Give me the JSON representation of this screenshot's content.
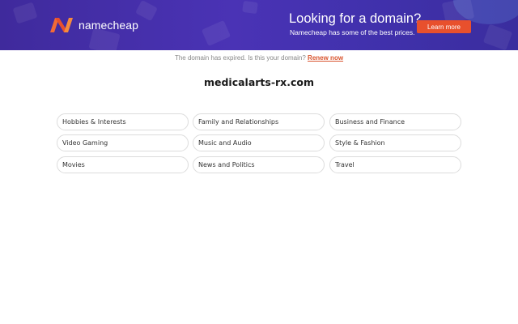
{
  "banner": {
    "logo_text": "namecheap",
    "logo_icon": "namecheap-n-icon",
    "promo_title": "Looking for a domain?",
    "promo_subtitle": "Namecheap has some of the best prices.",
    "learn_more_label": "Learn more",
    "colors": {
      "background": "#4a33b5",
      "button": "#e8502d",
      "accent": "#f26a36"
    }
  },
  "notice": {
    "text": "The domain has expired. Is this your domain?",
    "renew_label": "Renew now",
    "link_color": "#d9552f"
  },
  "domain_name": "medicalarts-rx.com",
  "categories": [
    "Hobbies & Interests",
    "Family and Relationships",
    "Business and Finance",
    "Video Gaming",
    "Music and Audio",
    "Style & Fashion",
    "Movies",
    "News and Politics",
    "Travel"
  ]
}
